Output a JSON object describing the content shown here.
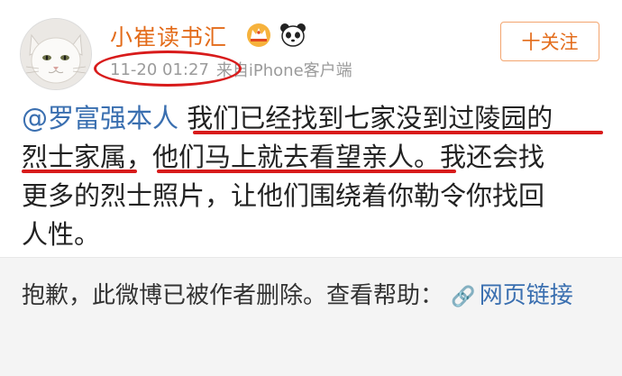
{
  "post": {
    "username": "小崔读书汇",
    "follow_label": "十关注",
    "time": "11-20 01:27",
    "source": "来自iPhone客户端",
    "mention": "@罗富强本人",
    "line1_rest": "我们已经找到七家没到过陵园的",
    "line2": "烈士家属，他们马上就去看望亲人。我还会找",
    "line3": "更多的烈士照片，让他们围绕着你勒令你找回",
    "line4": "人性。"
  },
  "notice": {
    "text": "抱歉，此微博已被作者删除。查看帮助：",
    "link": "网页链接"
  },
  "colors": {
    "username": "#e36c1b",
    "mention": "#3a6fb0",
    "annotation": "#d81b1b",
    "notice_bg": "#f4f4f4"
  },
  "icons": {
    "avatar": "cat-avatar",
    "badge1": "crown-icon",
    "badge2": "panda-icon",
    "link": "link-icon"
  }
}
